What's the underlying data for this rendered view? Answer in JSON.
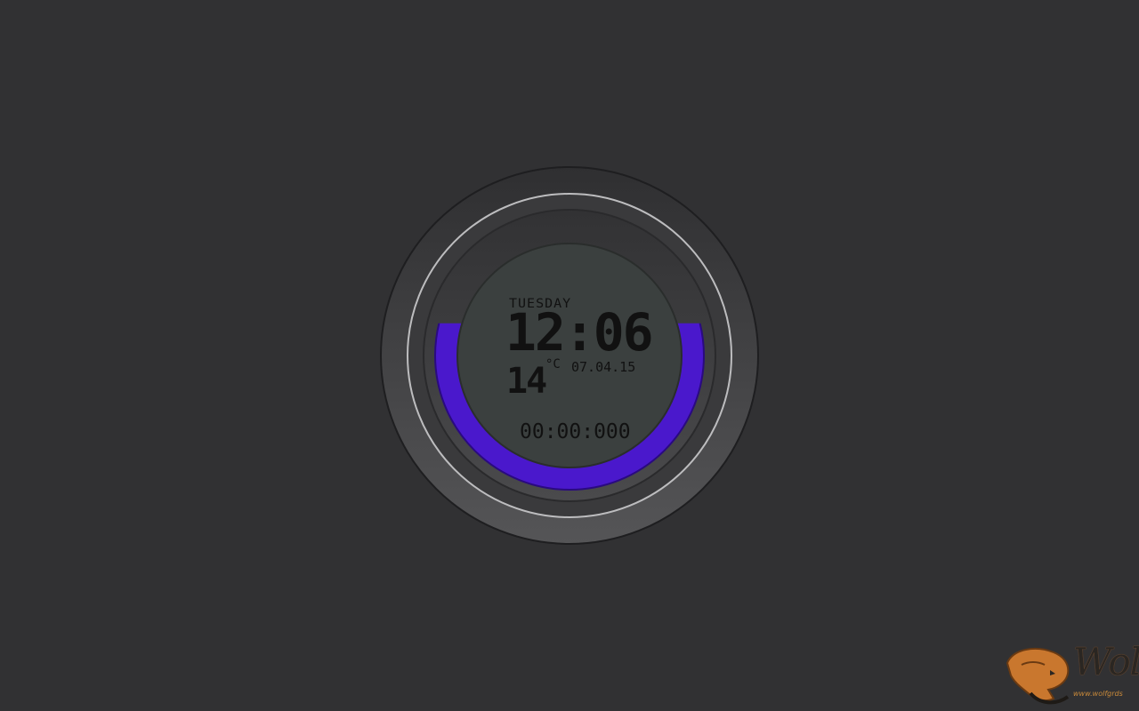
{
  "clock": {
    "day": "TUESDAY",
    "time": "12:06",
    "temperature": "14",
    "temperature_unit": "°C",
    "date": "07.04.15",
    "stopwatch": "00:00:000",
    "ring_level_percent": 62
  },
  "colors": {
    "background": "#313133",
    "bezel": "#474749",
    "lcd": "#3b403f",
    "accent_ring": "#4a18cc",
    "lcd_text": "#111111"
  },
  "logo": {
    "word": "WolF",
    "url": "www.wolfgrds"
  }
}
